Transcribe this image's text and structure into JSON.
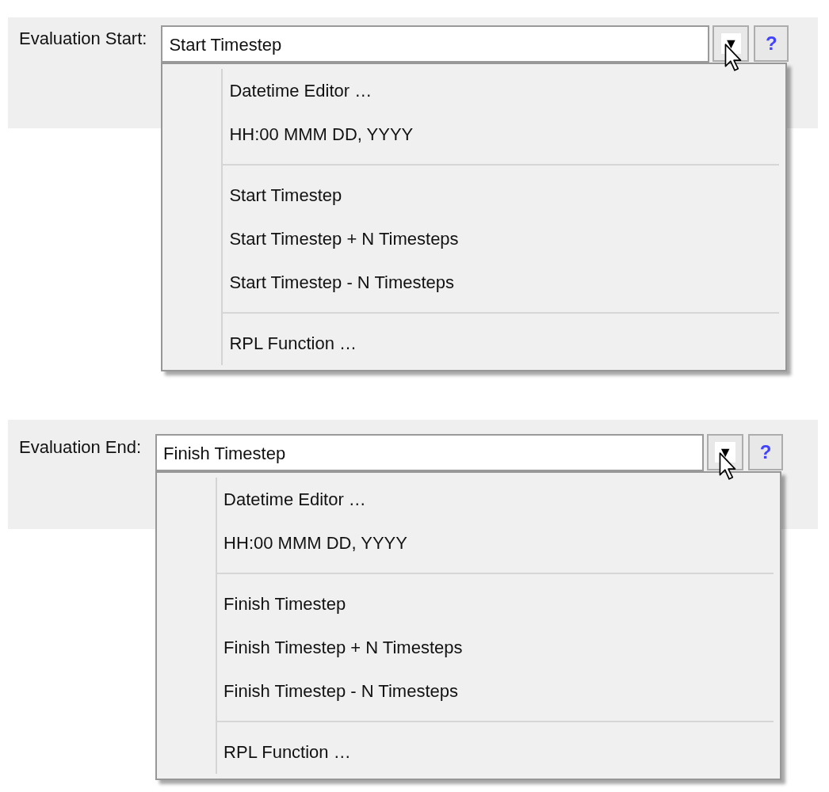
{
  "fields": [
    {
      "label": "Evaluation Start:",
      "value": "Start Timestep",
      "dropdown_button": "▼",
      "help_button": "?",
      "menu": {
        "expanded": true,
        "groups": [
          [
            "Datetime Editor …",
            "HH:00 MMM DD, YYYY"
          ],
          [
            "Start Timestep",
            "Start Timestep + N Timesteps",
            "Start Timestep - N Timesteps"
          ],
          [
            "RPL Function …"
          ]
        ]
      }
    },
    {
      "label": "Evaluation End:",
      "value": "Finish Timestep",
      "dropdown_button": "▼",
      "help_button": "?",
      "menu": {
        "expanded": true,
        "groups": [
          [
            "Datetime Editor …",
            "HH:00 MMM DD, YYYY"
          ],
          [
            "Finish Timestep",
            "Finish Timestep + N Timesteps",
            "Finish Timestep - N Timesteps"
          ],
          [
            "RPL Function …"
          ]
        ]
      }
    }
  ]
}
